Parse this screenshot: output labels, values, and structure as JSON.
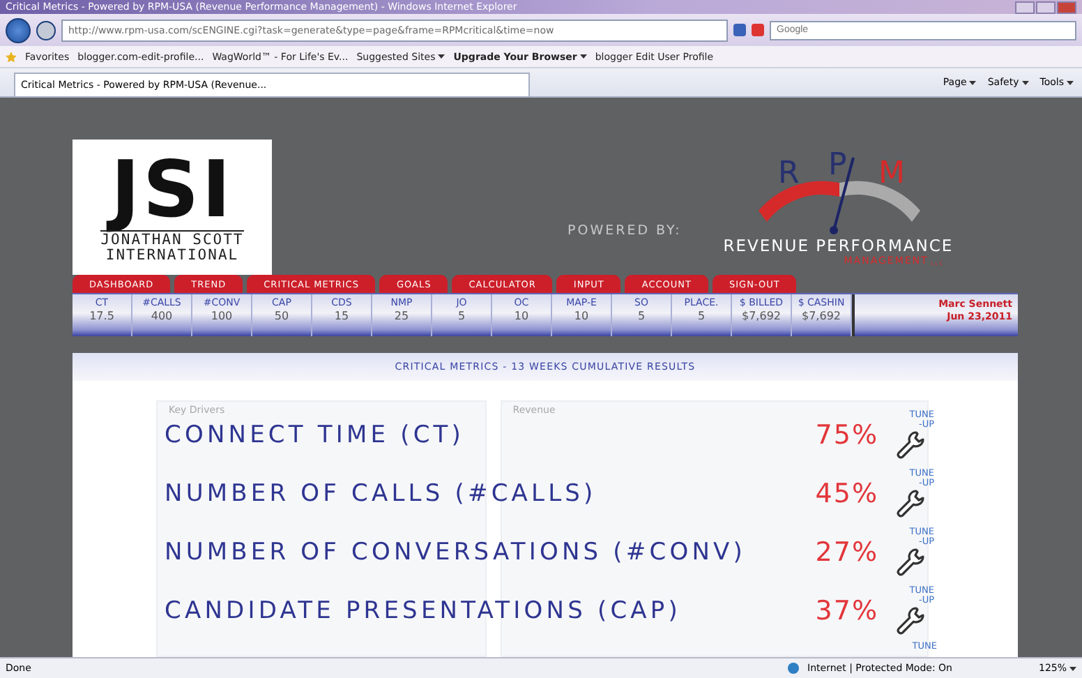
{
  "window": {
    "title": "Critical Metrics - Powered by RPM-USA (Revenue Performance Management) - Windows Internet Explorer"
  },
  "address_bar": {
    "url": "http://www.rpm-usa.com/scENGINE.cgi?task=generate&type=page&frame=RPMcritical&time=now",
    "search_placeholder": "Google"
  },
  "favorites_bar": {
    "favorites": "Favorites",
    "items": [
      {
        "label": "blogger.com-edit-profile...",
        "dropdown": false,
        "bold": false
      },
      {
        "label": "WagWorld™ - For Life's Ev...",
        "dropdown": false,
        "bold": false
      },
      {
        "label": "Suggested Sites",
        "dropdown": true,
        "bold": false
      },
      {
        "label": "Upgrade Your Browser",
        "dropdown": true,
        "bold": true
      },
      {
        "label": "blogger Edit User Profile",
        "dropdown": false,
        "bold": false
      }
    ]
  },
  "tab": {
    "title": "Critical Metrics - Powered by RPM-USA (Revenue..."
  },
  "command_bar": [
    "Page",
    "Safety",
    "Tools"
  ],
  "site": {
    "logo": {
      "mark": "JSI",
      "line1": "JONATHAN SCOTT",
      "line2": "INTERNATIONAL"
    },
    "powered_by": "POWERED BY:",
    "rpm_logo": {
      "letters": [
        "R",
        "P",
        "M"
      ],
      "name": "REVENUE PERFORMANCE",
      "sub": "MANAGEMENT",
      "suffix": "LLC"
    }
  },
  "nav": [
    {
      "label": "DASHBOARD",
      "selected": false
    },
    {
      "label": "TREND",
      "selected": false
    },
    {
      "label": "CRITICAL METRICS",
      "selected": false
    },
    {
      "label": "GOALS",
      "selected": false
    },
    {
      "label": "CALCULATOR",
      "selected": false
    },
    {
      "label": "INPUT",
      "selected": false
    },
    {
      "label": "ACCOUNT",
      "selected": false
    },
    {
      "label": "SIGN-OUT",
      "selected": false
    }
  ],
  "metrics": [
    {
      "label": "CT",
      "value": "17.5"
    },
    {
      "label": "#CALLS",
      "value": "400"
    },
    {
      "label": "#CONV",
      "value": "100"
    },
    {
      "label": "CAP",
      "value": "50"
    },
    {
      "label": "CDS",
      "value": "15"
    },
    {
      "label": "NMP",
      "value": "25"
    },
    {
      "label": "JO",
      "value": "5"
    },
    {
      "label": "OC",
      "value": "10"
    },
    {
      "label": "MAP-E",
      "value": "10"
    },
    {
      "label": "SO",
      "value": "5"
    },
    {
      "label": "PLACE.",
      "value": "5"
    },
    {
      "label": "$ BILLED",
      "value": "$7,692"
    },
    {
      "label": "$ CASHIN",
      "value": "$7,692"
    }
  ],
  "user": {
    "name": "Marc Sennett",
    "date": "Jun 23,2011"
  },
  "panel": {
    "title": "CRITICAL METRICS - 13 WEEKS CUMULATIVE RESULTS",
    "background": {
      "left_label": "Key Drivers",
      "right_label": "Revenue"
    },
    "rows": [
      {
        "label": "CONNECT TIME (CT)",
        "percent": "75%",
        "action": [
          "TUNE",
          "-UP"
        ]
      },
      {
        "label": "NUMBER OF CALLS (#CALLS)",
        "percent": "45%",
        "action": [
          "TUNE",
          "-UP"
        ]
      },
      {
        "label": "NUMBER OF CONVERSATIONS (#CONV)",
        "percent": "27%",
        "action": [
          "TUNE",
          "-UP"
        ]
      },
      {
        "label": "CANDIDATE PRESENTATIONS (CAP)",
        "percent": "37%",
        "action": [
          "TUNE",
          "-UP"
        ]
      }
    ],
    "cut_off_action": "TUNE"
  },
  "status_bar": {
    "text": "Done",
    "zone": "Internet | Protected Mode: On",
    "zoom": "125%"
  }
}
